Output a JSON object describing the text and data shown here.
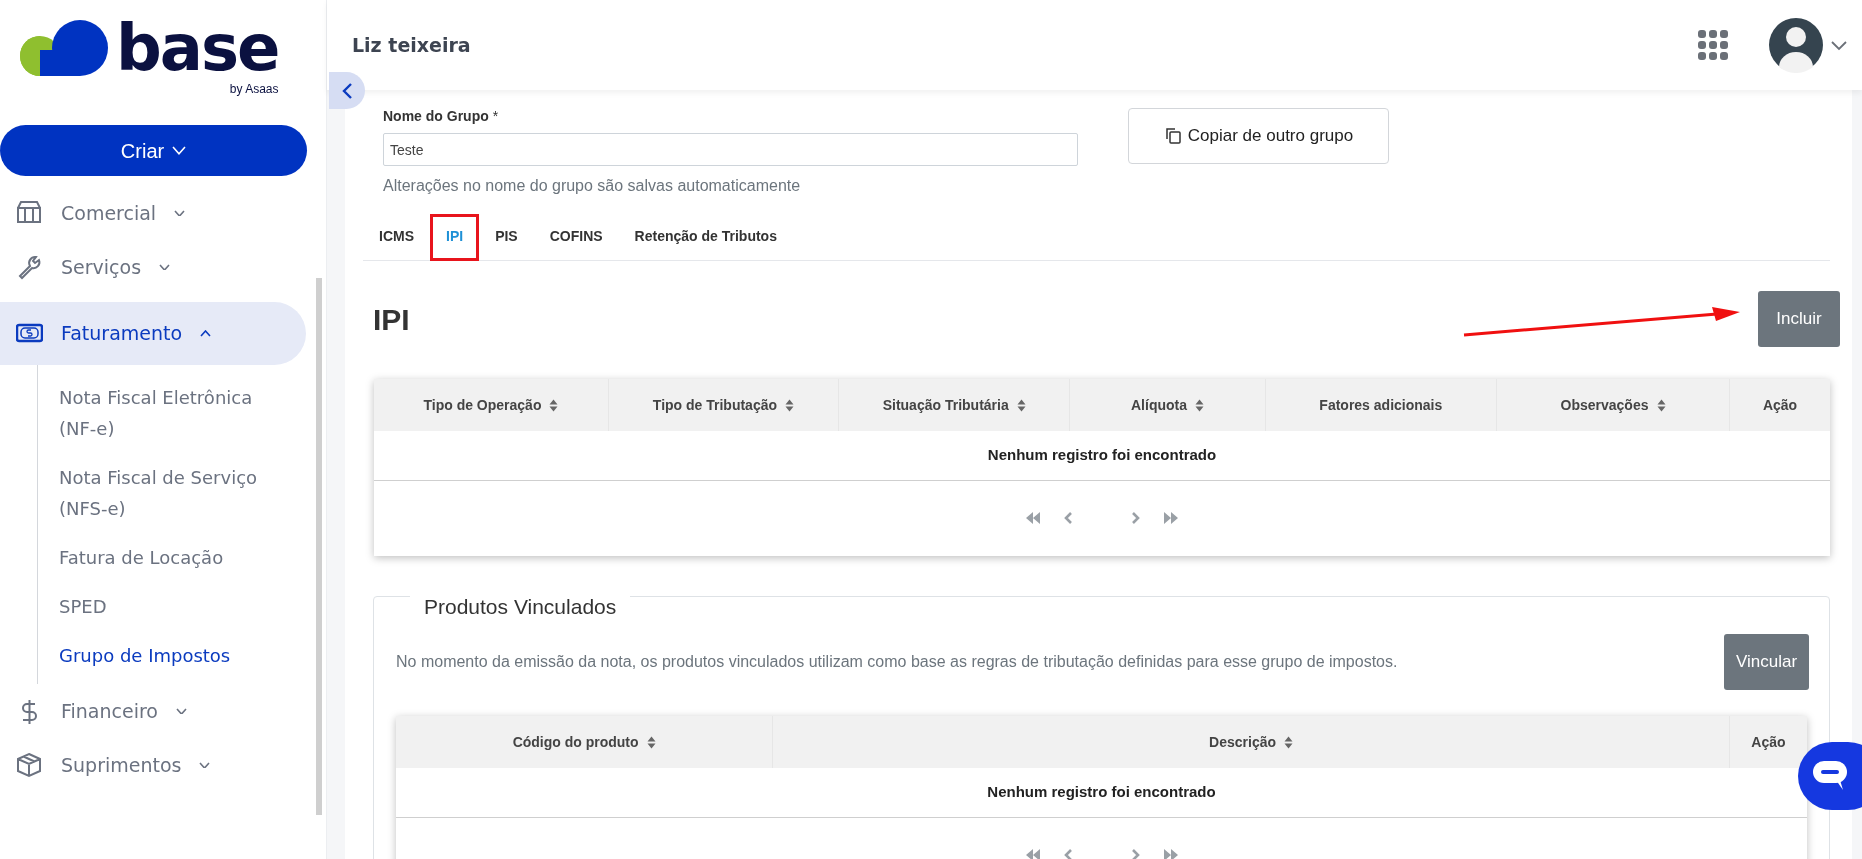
{
  "logo": {
    "wordmark": "base",
    "tagline": "by Asaas"
  },
  "create_button": {
    "label": "Criar"
  },
  "sidebar": {
    "items": [
      {
        "label": "Comercial",
        "expanded": false,
        "selected": false
      },
      {
        "label": "Serviços",
        "expanded": false,
        "selected": false
      },
      {
        "label": "Faturamento",
        "expanded": true,
        "selected": true,
        "children": [
          {
            "label": "Nota Fiscal Eletrônica (NF-e)",
            "selected": false
          },
          {
            "label": "Nota Fiscal de Serviço (NFS-e)",
            "selected": false
          },
          {
            "label": "Fatura de Locação",
            "selected": false
          },
          {
            "label": "SPED",
            "selected": false
          },
          {
            "label": "Grupo de Impostos",
            "selected": true
          }
        ]
      },
      {
        "label": "Financeiro",
        "expanded": false,
        "selected": false
      },
      {
        "label": "Suprimentos",
        "expanded": false,
        "selected": false
      }
    ]
  },
  "header": {
    "title": "Liz teixeira"
  },
  "form": {
    "label": "Nome do Grupo",
    "required_mark": "*",
    "value": "Teste",
    "help": "Alterações no nome do grupo são salvas automaticamente",
    "copy_button": "Copiar de outro grupo"
  },
  "tabs": [
    {
      "label": "ICMS",
      "selected": false,
      "annotated": false
    },
    {
      "label": "IPI",
      "selected": true,
      "annotated": true
    },
    {
      "label": "PIS",
      "selected": false,
      "annotated": false
    },
    {
      "label": "COFINS",
      "selected": false,
      "annotated": false
    },
    {
      "label": "Retenção de Tributos",
      "selected": false,
      "annotated": false
    }
  ],
  "section": {
    "title": "IPI",
    "add_button": "Incluir",
    "table": {
      "columns": [
        {
          "label": "Tipo de Operação",
          "sortable": true
        },
        {
          "label": "Tipo de Tributação",
          "sortable": true
        },
        {
          "label": "Situação Tributária",
          "sortable": true
        },
        {
          "label": "Alíquota",
          "sortable": true
        },
        {
          "label": "Fatores adicionais",
          "sortable": false
        },
        {
          "label": "Observações",
          "sortable": true
        },
        {
          "label": "Ação",
          "sortable": false
        }
      ],
      "empty_message": "Nenhum registro foi encontrado"
    }
  },
  "linked_products": {
    "legend": "Produtos Vinculados",
    "description": "No momento da emissão da nota, os produtos vinculados utilizam como base as regras de tributação definidas para esse grupo de impostos.",
    "button": "Vincular",
    "table": {
      "columns": [
        {
          "label": "Código do produto",
          "sortable": true
        },
        {
          "label": "Descrição",
          "sortable": true
        },
        {
          "label": "Ação",
          "sortable": false
        }
      ],
      "empty_message": "Nenhum registro foi encontrado"
    }
  }
}
